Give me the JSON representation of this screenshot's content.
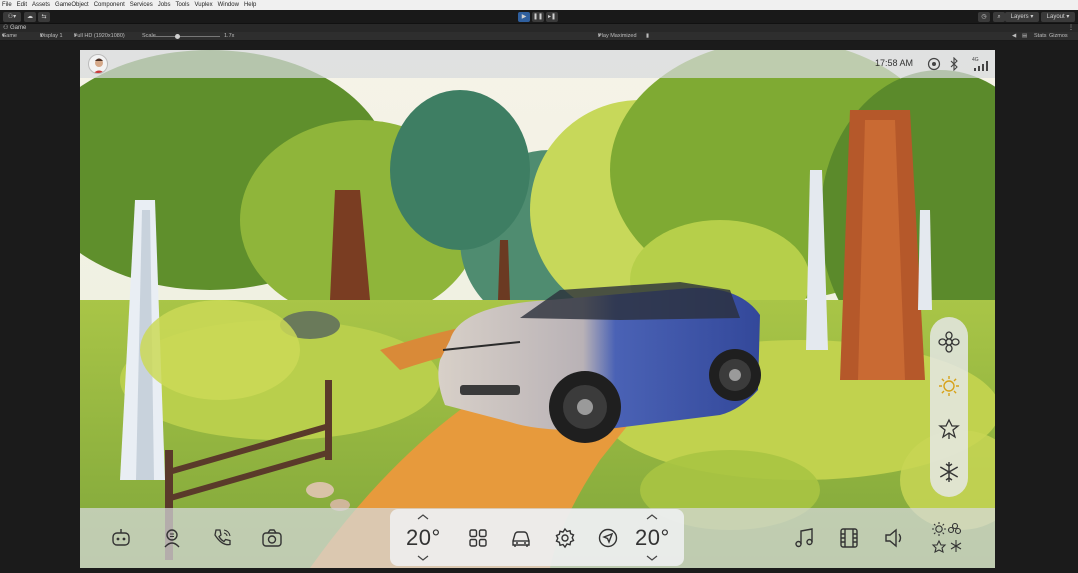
{
  "menu": [
    "File",
    "Edit",
    "Assets",
    "GameObject",
    "Component",
    "Services",
    "Jobs",
    "Tools",
    "Vuplex",
    "Window",
    "Help"
  ],
  "toolbar": {
    "layers_label": "Layers",
    "layout_label": "Layout"
  },
  "tab": {
    "label": "Game"
  },
  "game_toolbar": {
    "view_mode": "Game",
    "display": "Display 1",
    "resolution": "Full HD (1920x1080)",
    "scale_label": "Scale",
    "scale_value": "1.7x",
    "play_mode": "Play Maximized",
    "stats": "Stats",
    "gizmos": "Gizmos"
  },
  "status": {
    "time": "17:58 AM",
    "signal_label": "4G"
  },
  "hvac": {
    "left_temp": "20°",
    "right_temp": "20°"
  },
  "icons": {
    "climate": [
      "flower-icon",
      "sun-icon",
      "leaf-icon",
      "snowflake-icon"
    ],
    "left": [
      "robot-icon",
      "voice-assistant-icon",
      "phone-icon",
      "camera-icon"
    ],
    "center": [
      "apps-grid-icon",
      "car-icon",
      "settings-icon",
      "navigation-icon"
    ],
    "right": [
      "music-icon",
      "film-icon",
      "volume-icon",
      "weather-seasons-icon"
    ]
  },
  "colors": {
    "car": "#3c55a8",
    "panel": "#d7dade",
    "chrome_dark": "#1b1b1b"
  }
}
